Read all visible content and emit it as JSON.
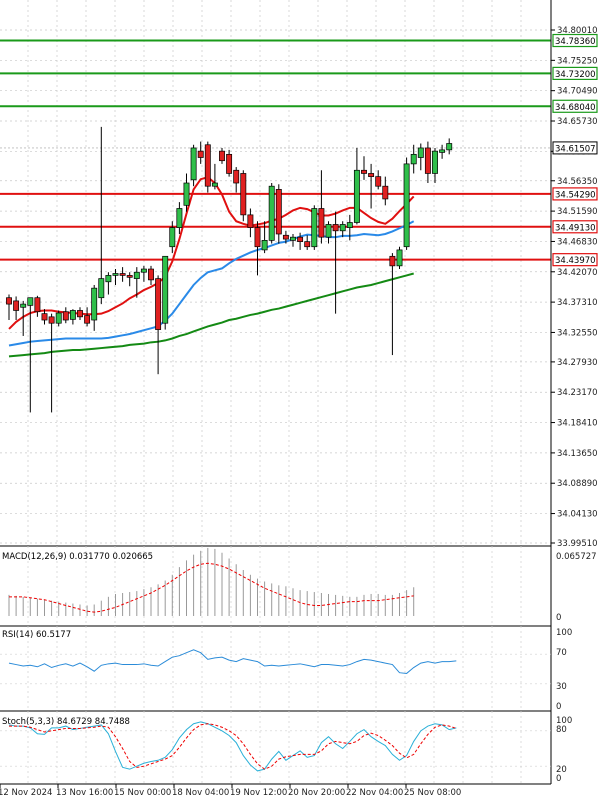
{
  "chart_data": {
    "type": "candlestick",
    "price_axis": {
      "ticks": [
        "34.80010",
        "34.75250",
        "34.70490",
        "34.65730",
        "34.60970",
        "34.56350",
        "34.51590",
        "34.46830",
        "34.42070",
        "34.37310",
        "34.32550",
        "34.27930",
        "34.23170",
        "34.18410",
        "34.13650",
        "34.08890",
        "34.04130",
        "33.99510"
      ],
      "range": [
        33.9951,
        34.8001
      ]
    },
    "time_axis": {
      "labels": [
        "12 Nov 2024",
        "13 Nov 16:00",
        "15 Nov 00:00",
        "18 Nov 04:00",
        "19 Nov 12:00",
        "20 Nov 20:00",
        "22 Nov 04:00",
        "25 Nov 08:00"
      ]
    },
    "levels": {
      "resistance": [
        34.7836,
        34.732,
        34.6804
      ],
      "support": [
        34.5429,
        34.4913,
        34.4397
      ],
      "current": 34.61507,
      "labels": {
        "r1": "34.78360",
        "r2": "34.73200",
        "r3": "34.68040",
        "current": "34.61507",
        "s1": "34.54290",
        "s2": "34.49130",
        "s3": "34.43970"
      }
    },
    "ma_fast": [
      34.331,
      34.342,
      34.35,
      34.356,
      34.359,
      34.36,
      34.36,
      34.358,
      34.357,
      34.356,
      34.355,
      34.354,
      34.354,
      34.355,
      34.359,
      34.365,
      34.371,
      34.379,
      34.385,
      34.392,
      34.397,
      34.403,
      34.413,
      34.437,
      34.472,
      34.512,
      34.55,
      34.566,
      34.569,
      34.56,
      34.542,
      34.515,
      34.5,
      34.496,
      34.493,
      34.495,
      34.497,
      34.501,
      34.504,
      34.51,
      34.517,
      34.521,
      34.519,
      34.514,
      34.509,
      34.509,
      34.512,
      34.517,
      34.521,
      34.521,
      34.513,
      34.505,
      34.499,
      34.496,
      34.504,
      34.516,
      34.527,
      34.539
    ],
    "ma_slow": [
      34.305,
      34.307,
      34.309,
      34.311,
      34.312,
      34.313,
      34.314,
      34.315,
      34.316,
      34.316,
      34.316,
      34.316,
      34.316,
      34.316,
      34.317,
      34.319,
      34.321,
      34.323,
      34.326,
      34.329,
      34.332,
      34.335,
      34.344,
      34.355,
      34.37,
      34.385,
      34.4,
      34.411,
      34.42,
      34.423,
      34.426,
      34.434,
      34.441,
      34.446,
      34.451,
      34.455,
      34.458,
      34.462,
      34.466,
      34.468,
      34.472,
      34.476,
      34.479,
      34.478,
      34.477,
      34.475,
      34.475,
      34.477,
      34.477,
      34.478,
      34.48,
      34.479,
      34.478,
      34.48,
      34.484,
      34.489,
      34.494,
      34.5
    ],
    "ma_long": [
      34.288,
      34.289,
      34.29,
      34.291,
      34.292,
      34.293,
      34.295,
      34.296,
      34.297,
      34.298,
      34.298,
      34.299,
      34.3,
      34.301,
      34.302,
      34.303,
      34.304,
      34.306,
      34.307,
      34.308,
      34.31,
      34.311,
      34.313,
      34.316,
      34.32,
      34.323,
      34.327,
      34.331,
      34.335,
      34.338,
      34.341,
      34.345,
      34.347,
      34.35,
      34.353,
      34.355,
      34.358,
      34.361,
      34.363,
      34.366,
      34.369,
      34.372,
      34.375,
      34.378,
      34.381,
      34.384,
      34.387,
      34.39,
      34.393,
      34.396,
      34.398,
      34.4,
      34.403,
      34.406,
      34.409,
      34.412,
      34.415,
      34.418
    ],
    "candles": [
      {
        "o": 34.38,
        "h": 34.385,
        "l": 34.345,
        "c": 34.37
      },
      {
        "o": 34.375,
        "h": 34.382,
        "l": 34.345,
        "c": 34.36
      },
      {
        "o": 34.365,
        "h": 34.375,
        "l": 34.32,
        "c": 34.37
      },
      {
        "o": 34.368,
        "h": 34.378,
        "l": 34.2,
        "c": 34.38
      },
      {
        "o": 34.38,
        "h": 34.383,
        "l": 34.35,
        "c": 34.358
      },
      {
        "o": 34.355,
        "h": 34.362,
        "l": 34.338,
        "c": 34.345
      },
      {
        "o": 34.35,
        "h": 34.355,
        "l": 34.2,
        "c": 34.34
      },
      {
        "o": 34.34,
        "h": 34.36,
        "l": 34.335,
        "c": 34.356
      },
      {
        "o": 34.358,
        "h": 34.365,
        "l": 34.34,
        "c": 34.345
      },
      {
        "o": 34.346,
        "h": 34.362,
        "l": 34.338,
        "c": 34.36
      },
      {
        "o": 34.36,
        "h": 34.365,
        "l": 34.345,
        "c": 34.35
      },
      {
        "o": 34.352,
        "h": 34.365,
        "l": 34.335,
        "c": 34.34
      },
      {
        "o": 34.345,
        "h": 34.4,
        "l": 34.328,
        "c": 34.395
      },
      {
        "o": 34.38,
        "h": 34.648,
        "l": 34.37,
        "c": 34.41
      },
      {
        "o": 34.405,
        "h": 34.42,
        "l": 34.385,
        "c": 34.415
      },
      {
        "o": 34.415,
        "h": 34.425,
        "l": 34.4,
        "c": 34.418
      },
      {
        "o": 34.418,
        "h": 34.428,
        "l": 34.405,
        "c": 34.415
      },
      {
        "o": 34.415,
        "h": 34.42,
        "l": 34.398,
        "c": 34.412
      },
      {
        "o": 34.41,
        "h": 34.428,
        "l": 34.38,
        "c": 34.42
      },
      {
        "o": 34.42,
        "h": 34.43,
        "l": 34.405,
        "c": 34.425
      },
      {
        "o": 34.425,
        "h": 34.43,
        "l": 34.4,
        "c": 34.408
      },
      {
        "o": 34.41,
        "h": 34.415,
        "l": 34.26,
        "c": 34.33
      },
      {
        "o": 34.34,
        "h": 34.445,
        "l": 34.33,
        "c": 34.445
      },
      {
        "o": 34.46,
        "h": 34.5,
        "l": 34.45,
        "c": 34.49
      },
      {
        "o": 34.49,
        "h": 34.53,
        "l": 34.48,
        "c": 34.52
      },
      {
        "o": 34.525,
        "h": 34.575,
        "l": 34.515,
        "c": 34.56
      },
      {
        "o": 34.565,
        "h": 34.62,
        "l": 34.555,
        "c": 34.615
      },
      {
        "o": 34.61,
        "h": 34.625,
        "l": 34.59,
        "c": 34.6
      },
      {
        "o": 34.62,
        "h": 34.625,
        "l": 34.545,
        "c": 34.555
      },
      {
        "o": 34.555,
        "h": 34.59,
        "l": 34.55,
        "c": 34.56
      },
      {
        "o": 34.61,
        "h": 34.615,
        "l": 34.59,
        "c": 34.595
      },
      {
        "o": 34.605,
        "h": 34.612,
        "l": 34.57,
        "c": 34.575
      },
      {
        "o": 34.58,
        "h": 34.585,
        "l": 34.545,
        "c": 34.56
      },
      {
        "o": 34.575,
        "h": 34.58,
        "l": 34.5,
        "c": 34.51
      },
      {
        "o": 34.51,
        "h": 34.52,
        "l": 34.475,
        "c": 34.49
      },
      {
        "o": 34.49,
        "h": 34.5,
        "l": 34.415,
        "c": 34.46
      },
      {
        "o": 34.455,
        "h": 34.5,
        "l": 34.45,
        "c": 34.47
      },
      {
        "o": 34.47,
        "h": 34.56,
        "l": 34.465,
        "c": 34.555
      },
      {
        "o": 34.55,
        "h": 34.558,
        "l": 34.465,
        "c": 34.48
      },
      {
        "o": 34.478,
        "h": 34.485,
        "l": 34.465,
        "c": 34.472
      },
      {
        "o": 34.47,
        "h": 34.48,
        "l": 34.46,
        "c": 34.475
      },
      {
        "o": 34.475,
        "h": 34.482,
        "l": 34.455,
        "c": 34.468
      },
      {
        "o": 34.468,
        "h": 34.478,
        "l": 34.455,
        "c": 34.46
      },
      {
        "o": 34.46,
        "h": 34.525,
        "l": 34.455,
        "c": 34.52
      },
      {
        "o": 34.52,
        "h": 34.58,
        "l": 34.465,
        "c": 34.475
      },
      {
        "o": 34.475,
        "h": 34.5,
        "l": 34.465,
        "c": 34.495
      },
      {
        "o": 34.495,
        "h": 34.515,
        "l": 34.355,
        "c": 34.485
      },
      {
        "o": 34.485,
        "h": 34.5,
        "l": 34.475,
        "c": 34.495
      },
      {
        "o": 34.49,
        "h": 34.51,
        "l": 34.47,
        "c": 34.498
      },
      {
        "o": 34.498,
        "h": 34.615,
        "l": 34.495,
        "c": 34.58
      },
      {
        "o": 34.58,
        "h": 34.602,
        "l": 34.565,
        "c": 34.575
      },
      {
        "o": 34.575,
        "h": 34.59,
        "l": 34.52,
        "c": 34.57
      },
      {
        "o": 34.57,
        "h": 34.58,
        "l": 34.55,
        "c": 34.555
      },
      {
        "o": 34.555,
        "h": 34.57,
        "l": 34.525,
        "c": 34.535
      },
      {
        "o": 34.445,
        "h": 34.45,
        "l": 34.29,
        "c": 34.43
      },
      {
        "o": 34.43,
        "h": 34.46,
        "l": 34.425,
        "c": 34.455
      },
      {
        "o": 34.46,
        "h": 34.6,
        "l": 34.455,
        "c": 34.59
      },
      {
        "o": 34.59,
        "h": 34.62,
        "l": 34.575,
        "c": 34.605
      }
    ],
    "tail_candles": [
      {
        "o": 34.6,
        "h": 34.622,
        "l": 34.58,
        "c": 34.615
      },
      {
        "o": 34.615,
        "h": 34.625,
        "l": 34.56,
        "c": 34.575
      },
      {
        "o": 34.575,
        "h": 34.615,
        "l": 34.56,
        "c": 34.61
      },
      {
        "o": 34.608,
        "h": 34.62,
        "l": 34.598,
        "c": 34.612
      },
      {
        "o": 34.612,
        "h": 34.63,
        "l": 34.605,
        "c": 34.622
      }
    ],
    "macd": {
      "label": "MACD(12,26,9) 0.031770 0.020665",
      "ticks": [
        "0.065727",
        "0"
      ],
      "range": [
        0,
        0.065727
      ],
      "hist": [
        0.022,
        0.021,
        0.02,
        0.019,
        0.018,
        0.017,
        0.016,
        0.015,
        0.014,
        0.013,
        0.012,
        0.011,
        0.012,
        0.016,
        0.02,
        0.023,
        0.024,
        0.025,
        0.026,
        0.028,
        0.03,
        0.033,
        0.037,
        0.043,
        0.051,
        0.058,
        0.064,
        0.068,
        0.071,
        0.07,
        0.066,
        0.06,
        0.054,
        0.048,
        0.043,
        0.039,
        0.036,
        0.034,
        0.032,
        0.031,
        0.029,
        0.027,
        0.026,
        0.025,
        0.024,
        0.023,
        0.022,
        0.021,
        0.02,
        0.02,
        0.022,
        0.023,
        0.023,
        0.022,
        0.022,
        0.024,
        0.027,
        0.03
      ],
      "signal": [
        0.02,
        0.02,
        0.02,
        0.019,
        0.018,
        0.017,
        0.015,
        0.013,
        0.011,
        0.009,
        0.007,
        0.005,
        0.004,
        0.005,
        0.007,
        0.009,
        0.012,
        0.015,
        0.018,
        0.021,
        0.024,
        0.028,
        0.032,
        0.037,
        0.042,
        0.047,
        0.051,
        0.054,
        0.055,
        0.054,
        0.052,
        0.049,
        0.045,
        0.041,
        0.037,
        0.033,
        0.029,
        0.026,
        0.023,
        0.02,
        0.017,
        0.014,
        0.012,
        0.011,
        0.011,
        0.012,
        0.013,
        0.014,
        0.015,
        0.015,
        0.016,
        0.016,
        0.016,
        0.017,
        0.018,
        0.019,
        0.02,
        0.021
      ]
    },
    "rsi": {
      "label": "RSI(14) 60.5177",
      "ticks": [
        "100",
        "70",
        "30",
        "0"
      ],
      "range": [
        0,
        100
      ],
      "values": [
        58,
        56,
        54,
        55,
        53,
        57,
        52,
        55,
        57,
        54,
        58,
        53,
        47,
        55,
        57,
        58,
        56,
        56,
        56,
        57,
        55,
        54,
        60,
        66,
        68,
        72,
        76,
        72,
        63,
        65,
        66,
        62,
        60,
        64,
        62,
        60,
        54,
        55,
        54,
        55,
        56,
        57,
        55,
        53,
        56,
        56,
        55,
        54,
        56,
        60,
        63,
        62,
        60,
        58,
        56,
        45,
        44,
        52,
        58,
        60,
        58,
        60,
        60,
        61
      ]
    },
    "stoch": {
      "label": "Stoch(5,3,3) 84.6729 84.7488",
      "ticks": [
        "100",
        "80",
        "20",
        "0"
      ],
      "range": [
        0,
        100
      ],
      "k": [
        90,
        88,
        88,
        85,
        75,
        74,
        85,
        85,
        88,
        82,
        84,
        86,
        88,
        90,
        75,
        45,
        18,
        15,
        20,
        25,
        28,
        30,
        35,
        48,
        68,
        82,
        92,
        95,
        92,
        86,
        80,
        72,
        60,
        38,
        22,
        12,
        15,
        32,
        45,
        30,
        38,
        46,
        35,
        38,
        60,
        70,
        58,
        50,
        62,
        75,
        82,
        70,
        62,
        55,
        40,
        30,
        38,
        62,
        80,
        88,
        92,
        90,
        82,
        85
      ],
      "d": [
        88,
        88,
        88,
        86,
        82,
        78,
        80,
        82,
        84,
        84,
        84,
        85,
        86,
        88,
        86,
        70,
        50,
        28,
        18,
        20,
        24,
        28,
        32,
        38,
        52,
        68,
        82,
        90,
        92,
        90,
        86,
        80,
        72,
        58,
        40,
        24,
        15,
        20,
        32,
        36,
        38,
        40,
        40,
        40,
        46,
        58,
        62,
        60,
        58,
        62,
        72,
        76,
        72,
        64,
        55,
        42,
        34,
        40,
        58,
        74,
        86,
        90,
        88,
        84
      ]
    }
  }
}
